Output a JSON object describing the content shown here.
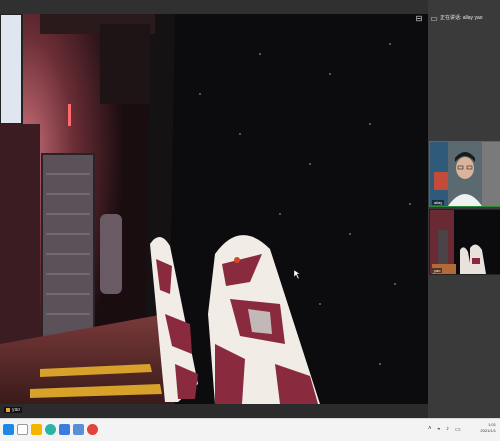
{
  "window": {
    "sidebar_title": "正在讲话: allay yao",
    "controls": {
      "minimize": "⊟",
      "close": "✕"
    }
  },
  "main_video": {
    "speaker_tag": "yao"
  },
  "participants": [
    {
      "name": "allay",
      "active": true
    },
    {
      "name": "yao",
      "active": false
    }
  ],
  "taskbar": {
    "time": "1:01",
    "date": "2021/1/1",
    "apps": [
      "windows-start-icon",
      "search-icon",
      "file-explorer-icon",
      "edge-browser-icon",
      "store-icon",
      "mail-icon",
      "chrome-icon"
    ]
  },
  "colors": {
    "active_border": "#2d8a3a",
    "background": "#2b2b2b",
    "taskbar": "#f3f3f3"
  }
}
